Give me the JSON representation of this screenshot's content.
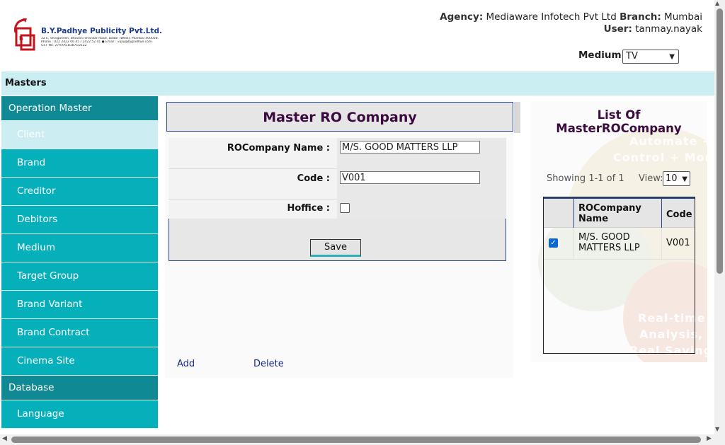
{
  "company": {
    "name": "B.Y.Padhye Publicity Pvt.Ltd.",
    "address_lines": [
      "32 E, Shivganesh, Bhavani Shankar Road, Dadar (West), Mumbai 400028.",
      "Phone : 022 2422 06 45 / 2422 52 41 ● Email : vijay@bypadhye.com",
      "GST No. 27AAACB1871D1Z2"
    ]
  },
  "header": {
    "agency_label": "Agency:",
    "agency_value": "Mediaware Infotech Pvt Ltd",
    "branch_label": "Branch:",
    "branch_value": "Mumbai",
    "user_label": "User:",
    "user_value": "tanmay.nayak",
    "medium_label": "Medium",
    "medium_value": "TV"
  },
  "masters_bar": "Masters",
  "nav": [
    {
      "type": "section",
      "label": "Operation Master"
    },
    {
      "type": "item",
      "label": "Client",
      "active": true
    },
    {
      "type": "item",
      "label": "Brand"
    },
    {
      "type": "item",
      "label": "Creditor"
    },
    {
      "type": "item",
      "label": "Debitors"
    },
    {
      "type": "item",
      "label": "Medium"
    },
    {
      "type": "item",
      "label": "Target Group"
    },
    {
      "type": "item",
      "label": "Brand Variant"
    },
    {
      "type": "item",
      "label": "Brand Contract"
    },
    {
      "type": "item",
      "label": "Cinema Site"
    },
    {
      "type": "section",
      "label": "Database"
    },
    {
      "type": "item",
      "label": "Language"
    }
  ],
  "form": {
    "title": "Master RO Company",
    "rocompany_label": "ROCompany Name :",
    "rocompany_value": "M/S. GOOD MATTERS LLP",
    "code_label": "Code :",
    "code_value": "V001",
    "hoffice_label": "Hoffice :",
    "hoffice_checked": false,
    "save_label": "Save",
    "add_label": "Add",
    "delete_label": "Delete"
  },
  "list": {
    "title_line1": "List Of",
    "title_line2": "MasterROCompany",
    "showing": "Showing 1-1 of 1",
    "view_label": "View:",
    "view_value": "10",
    "columns": [
      "ROCompany Name",
      "Code"
    ],
    "rows": [
      {
        "checked": true,
        "name": "M/S. GOOD MATTERS LLP",
        "code": "V001"
      }
    ]
  },
  "watermark": [
    "Automate +",
    "Control + Mon",
    "Real-time",
    "Analysis,",
    "Real Saving"
  ],
  "colors": {
    "nav_item": "#06b0bb",
    "nav_section": "#0f8a94",
    "masters_bar": "#cbeef2",
    "title_text": "#3b0a3e",
    "link": "#1a2a8a"
  }
}
